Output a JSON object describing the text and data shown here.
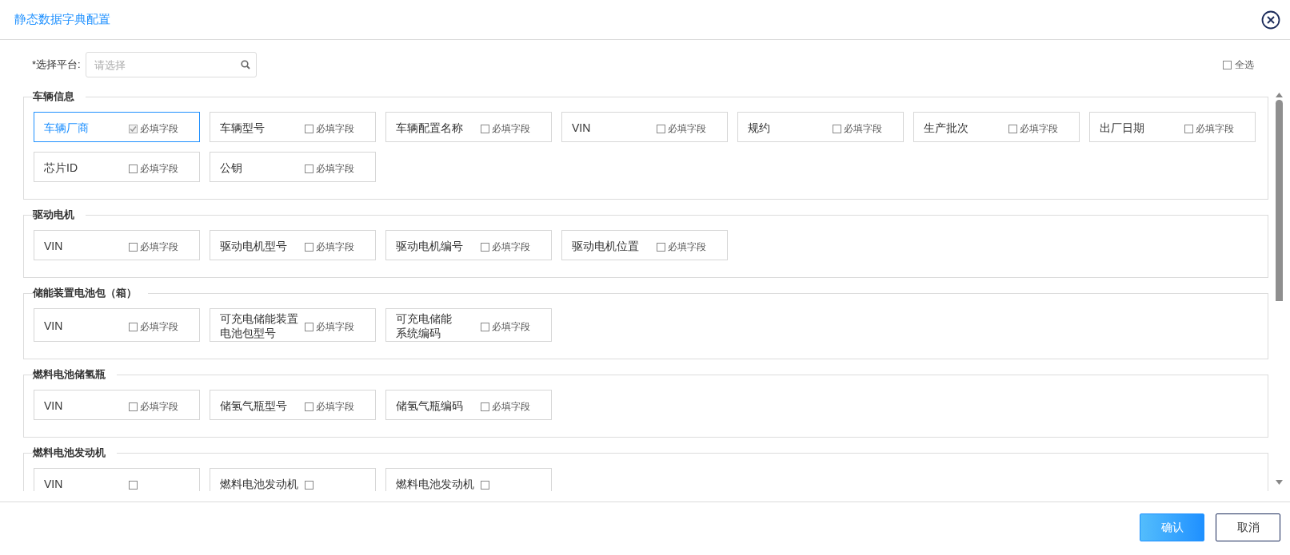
{
  "window": {
    "title": "静态数据字典配置"
  },
  "platform": {
    "label": "*选择平台:",
    "placeholder": "请选择"
  },
  "select_all": {
    "label": "全选",
    "checked": false
  },
  "sections": [
    {
      "title": "车辆信息",
      "fields": [
        {
          "name": "车辆厂商",
          "required_label": "必填字段",
          "checked": true,
          "selected": true
        },
        {
          "name": "车辆型号",
          "required_label": "必填字段",
          "checked": false,
          "selected": false
        },
        {
          "name": "车辆配置名称",
          "required_label": "必填字段",
          "checked": false,
          "selected": false
        },
        {
          "name": "VIN",
          "required_label": "必填字段",
          "checked": false,
          "selected": false
        },
        {
          "name": "规约",
          "required_label": "必填字段",
          "checked": false,
          "selected": false
        },
        {
          "name": "生产批次",
          "required_label": "必填字段",
          "checked": false,
          "selected": false
        },
        {
          "name": "出厂日期",
          "required_label": "必填字段",
          "checked": false,
          "selected": false
        },
        {
          "name": "芯片ID",
          "required_label": "必填字段",
          "checked": false,
          "selected": false
        },
        {
          "name": "公钥",
          "required_label": "必填字段",
          "checked": false,
          "selected": false
        }
      ]
    },
    {
      "title": "驱动电机",
      "fields": [
        {
          "name": "VIN",
          "required_label": "必填字段",
          "checked": false,
          "selected": false
        },
        {
          "name": "驱动电机型号",
          "required_label": "必填字段",
          "checked": false,
          "selected": false
        },
        {
          "name": "驱动电机编号",
          "required_label": "必填字段",
          "checked": false,
          "selected": false
        },
        {
          "name": "驱动电机位置",
          "required_label": "必填字段",
          "checked": false,
          "selected": false
        }
      ]
    },
    {
      "title": "储能装置电池包（箱）",
      "fields": [
        {
          "name": "VIN",
          "required_label": "必填字段",
          "checked": false,
          "selected": false
        },
        {
          "name_lines": [
            "可充电储能装置",
            "电池包型号"
          ],
          "required_label": "必填字段",
          "checked": false,
          "selected": false
        },
        {
          "name_lines": [
            "可充电储能",
            "系统编码"
          ],
          "required_label": "必填字段",
          "checked": false,
          "selected": false
        }
      ]
    },
    {
      "title": "燃料电池储氢瓶",
      "fields": [
        {
          "name": "VIN",
          "required_label": "必填字段",
          "checked": false,
          "selected": false
        },
        {
          "name": "储氢气瓶型号",
          "required_label": "必填字段",
          "checked": false,
          "selected": false
        },
        {
          "name": "储氢气瓶编码",
          "required_label": "必填字段",
          "checked": false,
          "selected": false
        }
      ]
    },
    {
      "title": "燃料电池发动机",
      "fields": [
        {
          "name": "VIN",
          "checked": false,
          "selected": false
        },
        {
          "name": "燃料电池发动机",
          "checked": false,
          "selected": false
        },
        {
          "name": "燃料电池发动机",
          "checked": false,
          "selected": false
        }
      ]
    }
  ],
  "buttons": [
    {
      "label": "确认",
      "kind": "primary"
    },
    {
      "label": "取消",
      "kind": "secondary"
    }
  ]
}
